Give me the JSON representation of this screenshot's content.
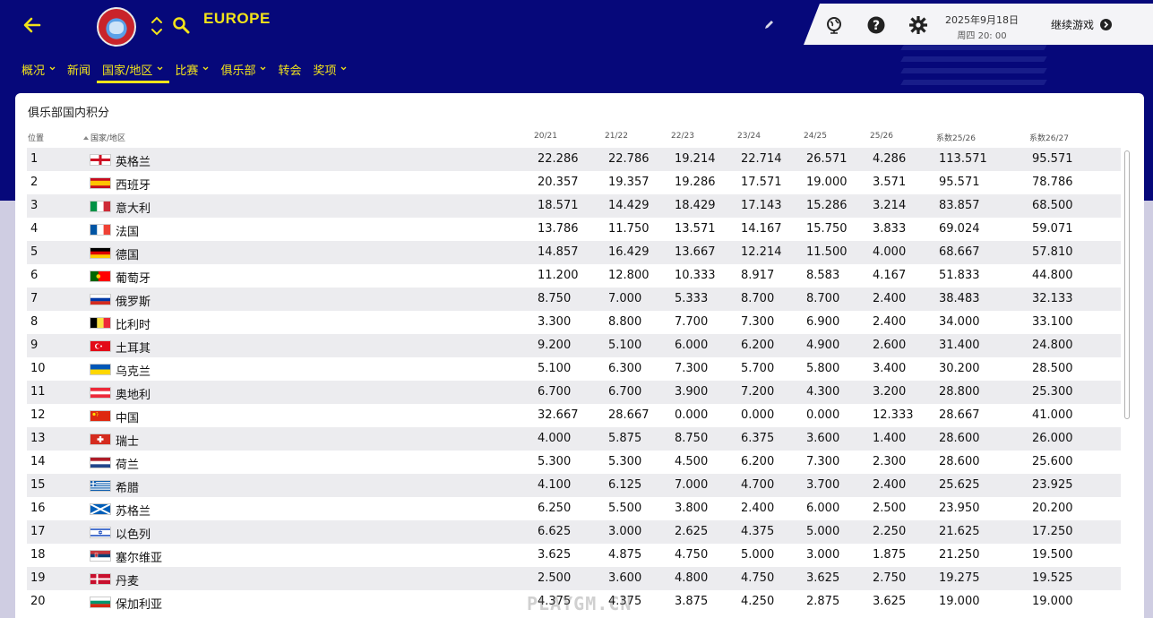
{
  "header": {
    "title": "EUROPE",
    "nav": [
      {
        "label": "概况",
        "has_menu": true,
        "active": false
      },
      {
        "label": "新闻",
        "has_menu": false,
        "active": false
      },
      {
        "label": "国家/地区",
        "has_menu": true,
        "active": true
      },
      {
        "label": "比赛",
        "has_menu": true,
        "active": false
      },
      {
        "label": "俱乐部",
        "has_menu": true,
        "active": false
      },
      {
        "label": "转会",
        "has_menu": false,
        "active": false
      },
      {
        "label": "奖项",
        "has_menu": true,
        "active": false
      }
    ]
  },
  "toolbar": {
    "date": "2025年9月18日",
    "time": "周四 20: 00",
    "continue_label": "继续游戏"
  },
  "panel": {
    "title": "俱乐部国内积分",
    "columns": [
      "位置",
      "国家/地区",
      "20/21",
      "21/22",
      "22/23",
      "23/24",
      "24/25",
      "25/26",
      "系数25/26",
      "系数26/27"
    ],
    "rows": [
      {
        "pos": "1",
        "flag": "england",
        "country": "英格兰",
        "v": [
          "22.286",
          "22.786",
          "19.214",
          "22.714",
          "26.571",
          "4.286",
          "113.571",
          "95.571"
        ]
      },
      {
        "pos": "2",
        "flag": "spain",
        "country": "西班牙",
        "v": [
          "20.357",
          "19.357",
          "19.286",
          "17.571",
          "19.000",
          "3.571",
          "95.571",
          "78.786"
        ]
      },
      {
        "pos": "3",
        "flag": "italy",
        "country": "意大利",
        "v": [
          "18.571",
          "14.429",
          "18.429",
          "17.143",
          "15.286",
          "3.214",
          "83.857",
          "68.500"
        ]
      },
      {
        "pos": "4",
        "flag": "france",
        "country": "法国",
        "v": [
          "13.786",
          "11.750",
          "13.571",
          "14.167",
          "15.750",
          "3.833",
          "69.024",
          "59.071"
        ]
      },
      {
        "pos": "5",
        "flag": "germany",
        "country": "德国",
        "v": [
          "14.857",
          "16.429",
          "13.667",
          "12.214",
          "11.500",
          "4.000",
          "68.667",
          "57.810"
        ]
      },
      {
        "pos": "6",
        "flag": "portugal",
        "country": "葡萄牙",
        "v": [
          "11.200",
          "12.800",
          "10.333",
          "8.917",
          "8.583",
          "4.167",
          "51.833",
          "44.800"
        ]
      },
      {
        "pos": "7",
        "flag": "russia",
        "country": "俄罗斯",
        "v": [
          "8.750",
          "7.000",
          "5.333",
          "8.700",
          "8.700",
          "2.400",
          "38.483",
          "32.133"
        ]
      },
      {
        "pos": "8",
        "flag": "belgium",
        "country": "比利时",
        "v": [
          "3.300",
          "8.800",
          "7.700",
          "7.300",
          "6.900",
          "2.400",
          "34.000",
          "33.100"
        ]
      },
      {
        "pos": "9",
        "flag": "turkey",
        "country": "土耳其",
        "v": [
          "9.200",
          "5.100",
          "6.000",
          "6.200",
          "4.900",
          "2.600",
          "31.400",
          "24.800"
        ]
      },
      {
        "pos": "10",
        "flag": "ukraine",
        "country": "乌克兰",
        "v": [
          "5.100",
          "6.300",
          "7.300",
          "5.700",
          "5.800",
          "3.400",
          "30.200",
          "28.500"
        ]
      },
      {
        "pos": "11",
        "flag": "austria",
        "country": "奥地利",
        "v": [
          "6.700",
          "6.700",
          "3.900",
          "7.200",
          "4.300",
          "3.200",
          "28.800",
          "25.300"
        ]
      },
      {
        "pos": "12",
        "flag": "china",
        "country": "中国",
        "v": [
          "32.667",
          "28.667",
          "0.000",
          "0.000",
          "0.000",
          "12.333",
          "28.667",
          "41.000"
        ]
      },
      {
        "pos": "13",
        "flag": "switzerland",
        "country": "瑞士",
        "v": [
          "4.000",
          "5.875",
          "8.750",
          "6.375",
          "3.600",
          "1.400",
          "28.600",
          "26.000"
        ]
      },
      {
        "pos": "14",
        "flag": "netherlands",
        "country": "荷兰",
        "v": [
          "5.300",
          "5.300",
          "4.500",
          "6.200",
          "7.300",
          "2.300",
          "28.600",
          "25.600"
        ]
      },
      {
        "pos": "15",
        "flag": "greece",
        "country": "希腊",
        "v": [
          "4.100",
          "6.125",
          "7.000",
          "4.700",
          "3.700",
          "2.400",
          "25.625",
          "23.925"
        ]
      },
      {
        "pos": "16",
        "flag": "scotland",
        "country": "苏格兰",
        "v": [
          "6.250",
          "5.500",
          "3.800",
          "2.400",
          "6.000",
          "2.500",
          "23.950",
          "20.200"
        ]
      },
      {
        "pos": "17",
        "flag": "israel",
        "country": "以色列",
        "v": [
          "6.625",
          "3.000",
          "2.625",
          "4.375",
          "5.000",
          "2.250",
          "21.625",
          "17.250"
        ]
      },
      {
        "pos": "18",
        "flag": "serbia",
        "country": "塞尔维亚",
        "v": [
          "3.625",
          "4.875",
          "4.750",
          "5.000",
          "3.000",
          "1.875",
          "21.250",
          "19.500"
        ]
      },
      {
        "pos": "19",
        "flag": "denmark",
        "country": "丹麦",
        "v": [
          "2.500",
          "3.600",
          "4.800",
          "4.750",
          "3.625",
          "2.750",
          "19.275",
          "19.525"
        ]
      },
      {
        "pos": "20",
        "flag": "bulgaria",
        "country": "保加利亚",
        "v": [
          "4.375",
          "4.375",
          "3.875",
          "4.250",
          "2.875",
          "3.625",
          "19.000",
          "19.000"
        ]
      }
    ]
  },
  "watermark": "PLAYGM.CN",
  "colors": {
    "header_bg": "#06087a",
    "accent": "#f2e31a",
    "panel_bg": "#ffffff",
    "row_alt": "#ececef"
  }
}
